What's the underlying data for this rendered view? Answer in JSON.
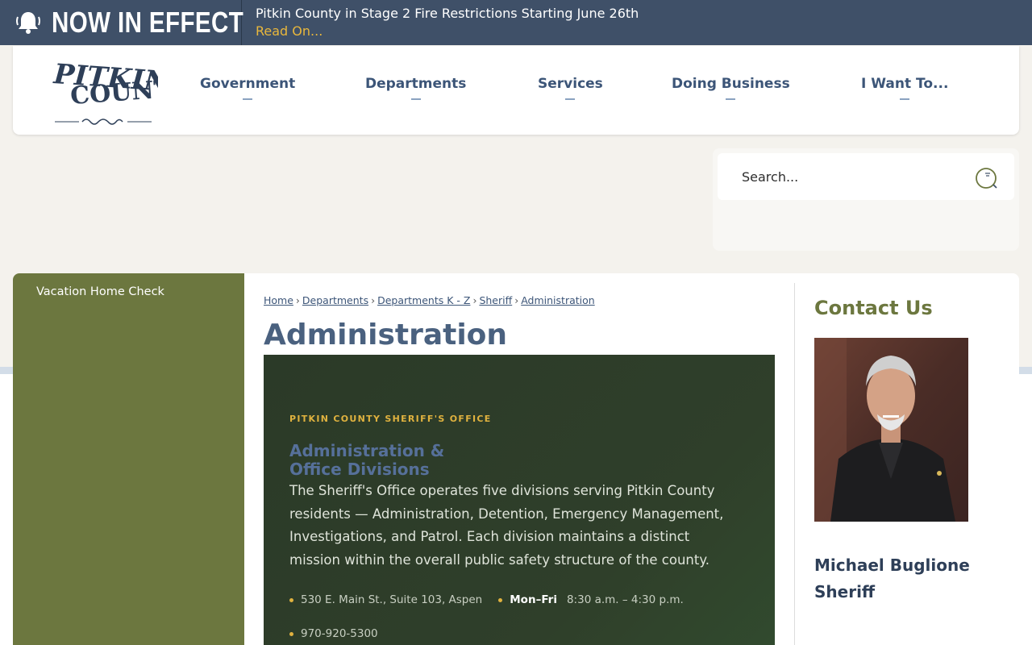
{
  "alert": {
    "title": "NOW IN EFFECT",
    "message": "Pitkin County in Stage 2 Fire Restrictions Starting June 26th",
    "link": "Read On...",
    "icon": "bell-icon"
  },
  "logo": {
    "line1": "PITKIN",
    "line2": "COUNTY"
  },
  "nav": {
    "items": [
      "Government",
      "Departments",
      "Services",
      "Doing Business",
      "I Want To..."
    ]
  },
  "search": {
    "placeholder": "Search...",
    "icon": "search-icon"
  },
  "sidebar": {
    "items": [
      "Vacation Home Check"
    ]
  },
  "breadcrumb": [
    "Home",
    "Departments",
    "Departments K - Z",
    "Sheriff",
    "Administration"
  ],
  "page": {
    "title": "Administration"
  },
  "hero": {
    "eyebrow": "PITKIN COUNTY SHERIFF'S OFFICE",
    "title_line1": "Administration &",
    "title_line2": "Office Divisions",
    "body": "The Sheriff's Office operates five divisions serving Pitkin County residents — Administration, Detention, Emergency Management, Investigations, and Patrol. Each division maintains a distinct mission within the overall public safety structure of the county.",
    "address": "530 E. Main St., Suite 103, Aspen",
    "days": "Mon–Fri",
    "hours": "8:30 a.m. – 4:30 p.m.",
    "phone": "970-920-5300"
  },
  "contact": {
    "title": "Contact Us",
    "name": "Michael Buglione",
    "role": "Sheriff"
  },
  "colors": {
    "alert_bg": "#3f5068",
    "accent_gold": "#e9b73c",
    "nav_blue": "#3c5578",
    "sidebar_green": "#6c773f",
    "hero_bg": "#2f3f2a"
  }
}
